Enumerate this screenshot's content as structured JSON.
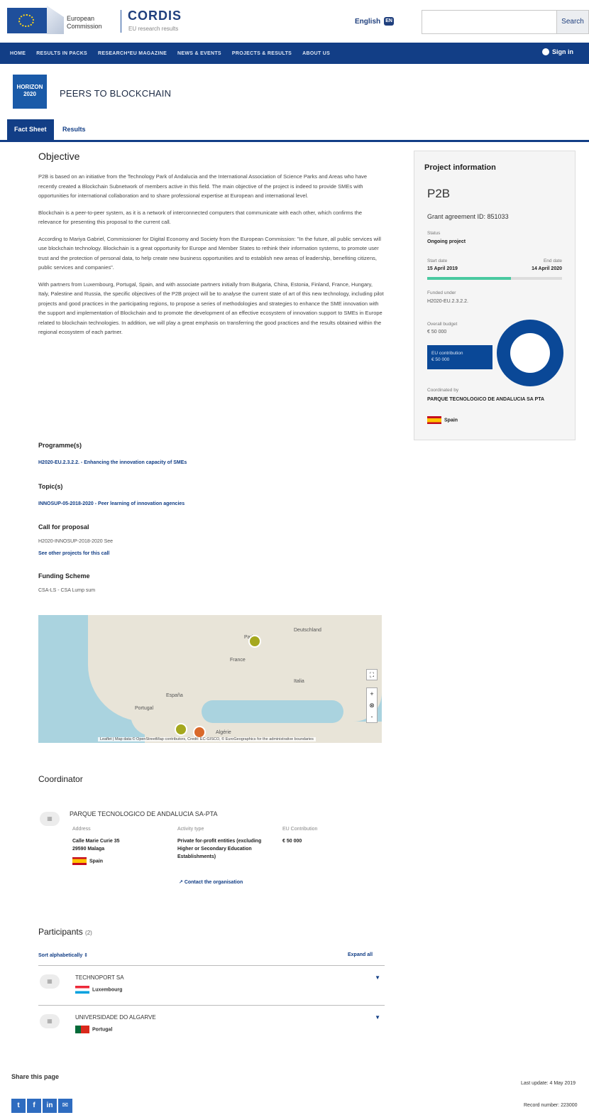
{
  "header": {
    "ec_line1": "European",
    "ec_line2": "Commission",
    "site_name": "CORDIS",
    "site_sub": "EU research results",
    "language": "English",
    "language_badge": "EN",
    "search_placeholder": "",
    "search_button": "Search"
  },
  "nav": {
    "items": [
      "HOME",
      "RESULTS IN PACKS",
      "RESEARCH*EU MAGAZINE",
      "NEWS & EVENTS",
      "PROJECTS & RESULTS",
      "ABOUT US"
    ],
    "signin": "Sign in"
  },
  "project": {
    "badge_line1": "HORIZON",
    "badge_line2": "2020",
    "title": "PEERS TO BLOCKCHAIN"
  },
  "tabs": {
    "fact_sheet": "Fact Sheet",
    "results": "Results"
  },
  "objective": {
    "heading": "Objective",
    "paragraphs": [
      "P2B is based on an initiative from the Technology Park of Andalucia and the International Association of Science Parks and Areas who have recently created a Blockchain Subnetwork of members active in this field. The main objective of the project is indeed to provide SMEs with opportunities for international collaboration and to share professional expertise at European and international level.",
      "Blockchain is a peer-to-peer system, as it is a network of interconnected computers that communicate with each other, which confirms the relevance for presenting this proposal to the current call.",
      "According to Mariya Gabriel, Commissioner for Digital Economy and Society from the European Commission: \"In the future, all public services will use blockchain technology. Blockchain is a great opportunity for Europe and Member States to rethink their information systems, to promote user trust and the protection of personal data, to help create new business opportunities and to establish new areas of leadership, benefiting citizens, public services and companies\".",
      "With partners from Luxembourg, Portugal, Spain, and with associate partners initially from Bulgaria, China, Estonia, Finland, France, Hungary, Italy, Palestine and Russia, the specific objectives of the P2B project will be to analyse the current state of art of this new technology, including pilot projects and good practices in the participating regions, to propose a series of methodologies and strategies to enhance the SME innovation with the support and implementation of Blockchain and to promote the development of an effective ecosystem of innovation support to SMEs in Europe related to blockchain technologies. In addition, we will play a great emphasis on transferring the good practices and the results obtained within the regional ecosystem of each partner."
    ]
  },
  "programme": {
    "heading": "Programme(s)",
    "link": "H2020-EU.2.3.2.2. - Enhancing the innovation capacity of SMEs"
  },
  "topic": {
    "heading": "Topic(s)",
    "link": "INNOSUP-05-2018-2020 - Peer learning of innovation agencies"
  },
  "call": {
    "heading": "Call for proposal",
    "value": "H2020-INNOSUP-2018-2020 See",
    "link": "See other projects for this call"
  },
  "funding": {
    "heading": "Funding Scheme",
    "value": "CSA-LS - CSA Lump sum"
  },
  "map": {
    "labels": [
      "Paris",
      "Deutschland",
      "France",
      "Italia",
      "España",
      "Portugal",
      "Algérie"
    ],
    "attribution": "Leaflet | Map data © OpenStreetMap contributors, Credit: EC-GISCO, © EuroGeographics for the administrative boundaries",
    "zoom_in": "+",
    "zoom_out": "-",
    "fullscreen": "⛶"
  },
  "coordinator": {
    "heading": "Coordinator",
    "name": "PARQUE TECNOLOGICO DE ANDALUCIA SA-PTA",
    "address_label": "Address",
    "address_line1": "Calle Marie Curie 35",
    "address_line2": "29590 Malaga",
    "country": "Spain",
    "activity_label": "Activity type",
    "activity_value": "Private for-profit entities (excluding Higher or Secondary Education Establishments)",
    "contribution_label": "EU Contribution",
    "contribution_value": "€ 50 000",
    "contact": "Contact the organisation"
  },
  "participants": {
    "heading": "Participants",
    "count": "(2)",
    "sort": "Sort alphabetically",
    "expand": "Expand all",
    "list": [
      {
        "name": "TECHNOPORT SA",
        "country": "Luxembourg",
        "flag": "lu"
      },
      {
        "name": "UNIVERSIDADE DO ALGARVE",
        "country": "Portugal",
        "flag": "pt"
      }
    ]
  },
  "sidebar": {
    "heading": "Project information",
    "acronym": "P2B",
    "grant": "Grant agreement ID: 851033",
    "status_label": "Status",
    "status_value": "Ongoing project",
    "start_label": "Start date",
    "start_value": "15 April 2019",
    "end_label": "End date",
    "end_value": "14 April 2020",
    "progress": 0.62,
    "progress_color": "#49c9a0",
    "funded_label": "Funded under",
    "funded_value": "H2020-EU.2.3.2.2.",
    "cost_label": "Overall budget",
    "cost_value": "€ 50 000",
    "eu_label": "EU contribution",
    "eu_value": "€ 50 000",
    "coordinated_label": "Coordinated by",
    "coordinated_value": "PARQUE TECNOLOGICO DE ANDALUCIA SA PTA",
    "coordinated_country": "Spain",
    "donut_color": "#0a4897"
  },
  "footer": {
    "share": "Share this page",
    "social": [
      "t",
      "f",
      "in",
      "✉"
    ],
    "last_update": "Last update: 4 May 2019",
    "record_number": "Record number: 223000"
  }
}
